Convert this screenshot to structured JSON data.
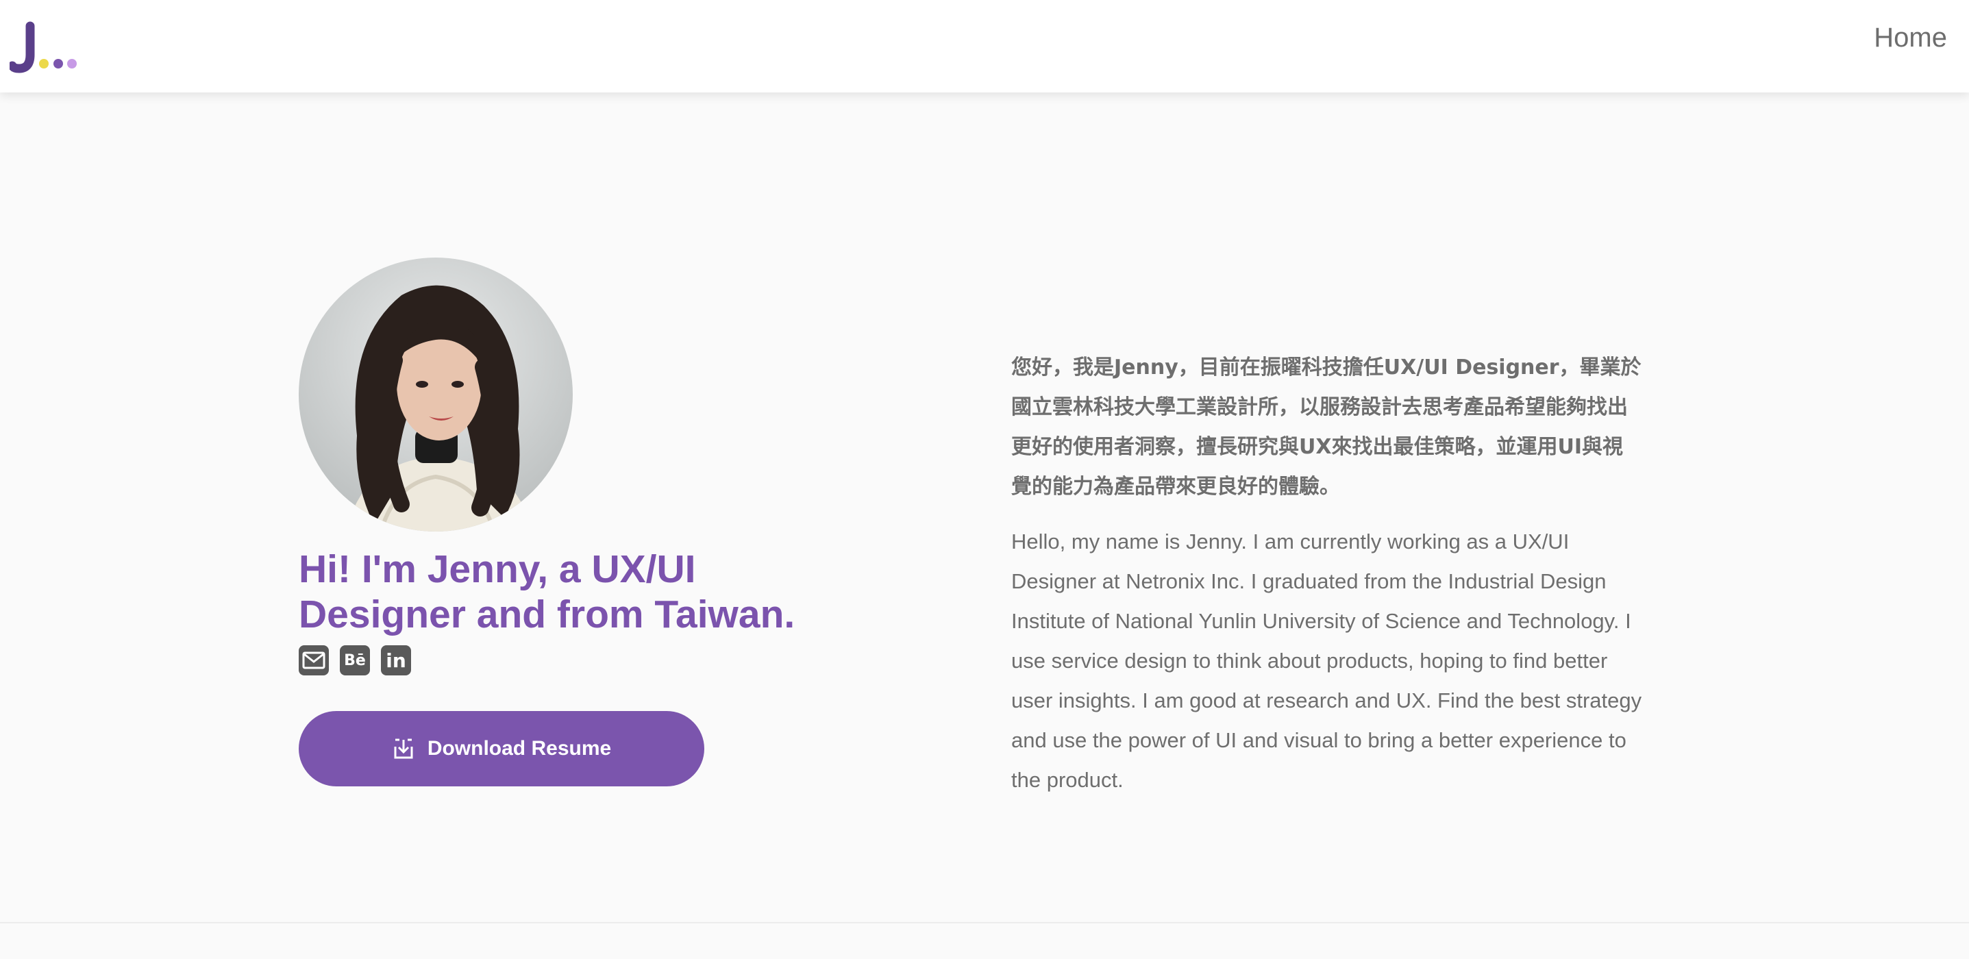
{
  "header": {
    "logo_letter": "J",
    "logo_dot_colors": [
      "#ecd94a",
      "#7b55ad",
      "#c79ae6"
    ],
    "nav": {
      "home_label": "Home"
    }
  },
  "hero": {
    "headline": "Hi! I'm Jenny, a UX/UI Designer and from Taiwan.",
    "avatar_icon": "profile-photo",
    "socials": [
      {
        "name": "email",
        "icon": "mail-icon",
        "text": ""
      },
      {
        "name": "behance",
        "icon": "behance-icon",
        "text": "Bē"
      },
      {
        "name": "linkedin",
        "icon": "linkedin-icon",
        "text": "in"
      }
    ],
    "download_label": "Download Resume",
    "intro_zh": "您好，我是Jenny，目前在振曜科技擔任UX/UI Designer，畢業於國立雲林科技大學工業設計所，以服務設計去思考產品希望能夠找出更好的使用者洞察，擅長研究與UX來找出最佳策略，並運用UI與視覺的能力為產品帶來更良好的體驗。",
    "intro_en": "Hello, my name is Jenny. I am currently working as a UX/UI Designer at Netronix Inc. I graduated from the Industrial Design Institute of National Yunlin University of Science and Technology. I use service design to think about products, hoping to find better user insights. I am good at research and UX. Find the best strategy and use the power of UI and visual to bring a better experience to the product."
  },
  "colors": {
    "accent": "#7b55ad",
    "text": "#6e6e6e",
    "icon_bg": "#595959"
  }
}
